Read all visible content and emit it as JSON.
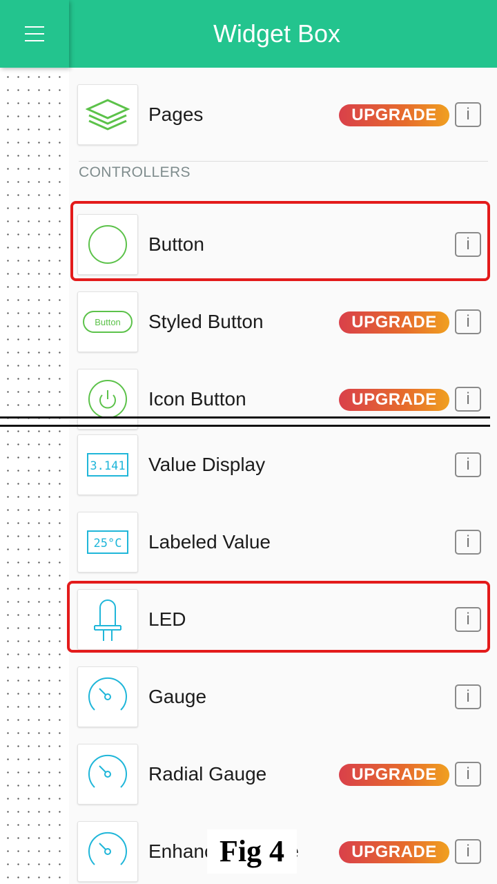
{
  "header": {
    "title": "Widget Box",
    "menu_icon": "hamburger-menu-icon"
  },
  "widgets": {
    "pages": {
      "label": "Pages",
      "icon": "layers-icon",
      "badge": "UPGRADE",
      "info": "i"
    },
    "section_controllers": "CONTROLLERS",
    "button": {
      "label": "Button",
      "icon": "circle-icon",
      "info": "i"
    },
    "styled_button": {
      "label": "Styled Button",
      "icon": "styled-button-icon",
      "icon_text": "Button",
      "badge": "UPGRADE",
      "info": "i"
    },
    "icon_button": {
      "label": "Icon Button",
      "icon": "power-icon",
      "badge": "UPGRADE",
      "info": "i"
    },
    "value_display": {
      "label": "Value Display",
      "icon": "value-display-icon",
      "icon_text": "3.141",
      "info": "i"
    },
    "labeled_value": {
      "label": "Labeled Value",
      "icon": "labeled-value-icon",
      "icon_text": "25°C",
      "info": "i"
    },
    "led": {
      "label": "LED",
      "icon": "led-icon",
      "info": "i"
    },
    "gauge": {
      "label": "Gauge",
      "icon": "gauge-icon",
      "info": "i"
    },
    "radial_gauge": {
      "label": "Radial Gauge",
      "icon": "gauge-icon",
      "badge": "UPGRADE",
      "info": "i"
    },
    "enhanced_gauge": {
      "label": "Enhanced Gauge",
      "icon": "gauge-icon",
      "badge": "UPGRADE",
      "info": "i"
    }
  },
  "caption": "Fig 4",
  "colors": {
    "header": "#23c48e",
    "green_icon": "#5cc24a",
    "blue_icon": "#1fb6d9",
    "highlight": "#e31b1b",
    "badge_start": "#d9404a",
    "badge_end": "#f0a020"
  }
}
